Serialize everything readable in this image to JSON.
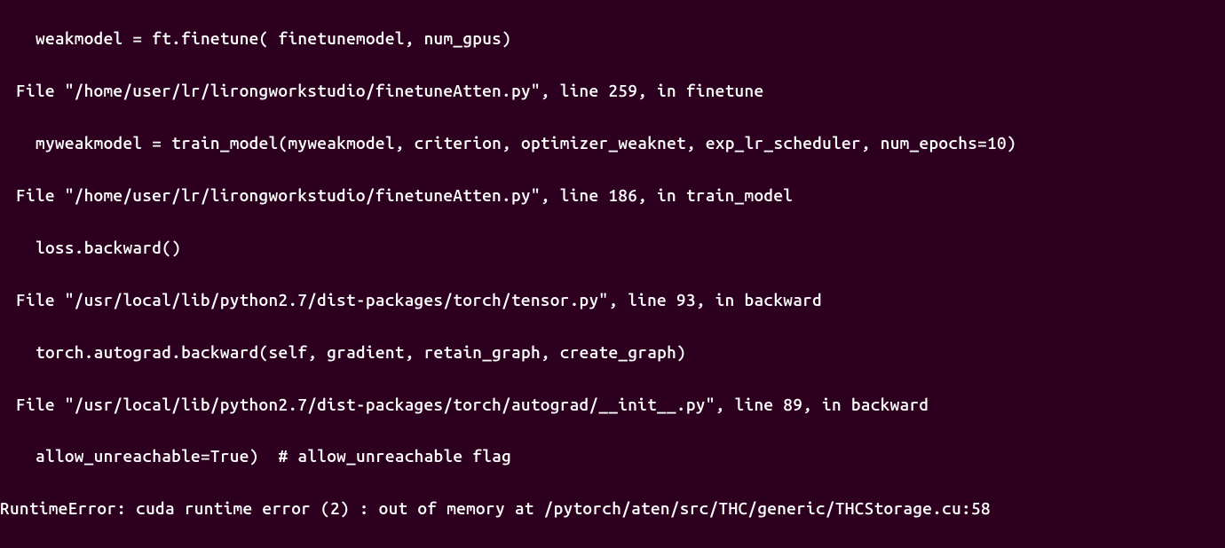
{
  "terminal": {
    "lines": [
      {
        "cls": "indent2",
        "text": "weakmodel = ft.finetune( finetunemodel, num_gpus)"
      },
      {
        "cls": "indent1",
        "text": "File \"/home/user/lr/lirongworkstudio/finetuneAtten.py\", line 259, in finetune"
      },
      {
        "cls": "indent2",
        "text": "myweakmodel = train_model(myweakmodel, criterion, optimizer_weaknet, exp_lr_scheduler, num_epochs=10)"
      },
      {
        "cls": "indent1",
        "text": "File \"/home/user/lr/lirongworkstudio/finetuneAtten.py\", line 186, in train_model"
      },
      {
        "cls": "indent2",
        "text": "loss.backward()"
      },
      {
        "cls": "indent1",
        "text": "File \"/usr/local/lib/python2.7/dist-packages/torch/tensor.py\", line 93, in backward"
      },
      {
        "cls": "indent2",
        "text": "torch.autograd.backward(self, gradient, retain_graph, create_graph)"
      },
      {
        "cls": "indent1",
        "text": "File \"/usr/local/lib/python2.7/dist-packages/torch/autograd/__init__.py\", line 89, in backward"
      },
      {
        "cls": "indent2",
        "text": "allow_unreachable=True)  # allow_unreachable flag"
      },
      {
        "cls": "noindent",
        "text": "RuntimeError: cuda runtime error (2) : out of memory at /pytorch/aten/src/THC/generic/THCStorage.cu:58"
      }
    ]
  }
}
